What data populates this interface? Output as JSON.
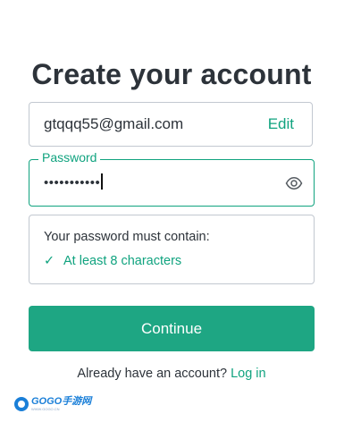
{
  "title": "Create your account",
  "email": {
    "value": "gtqqq55@gmail.com",
    "edit_label": "Edit"
  },
  "password": {
    "label": "Password",
    "masked_value": "•••••••••••"
  },
  "requirements": {
    "title": "Your password must contain:",
    "items": [
      {
        "check": "✓",
        "label": "At least 8 characters"
      }
    ]
  },
  "continue_label": "Continue",
  "login": {
    "prompt": "Already have an account?",
    "link_label": "Log in"
  },
  "watermark": {
    "main": "GOGO手游网",
    "sub": "WWW.GOGO.CN"
  },
  "colors": {
    "accent": "#10a37f",
    "button": "#1ea683",
    "text": "#2d333a",
    "border": "#c2c8d0"
  },
  "icons": {
    "password_toggle": "eye-icon",
    "requirement_met": "check-icon"
  }
}
